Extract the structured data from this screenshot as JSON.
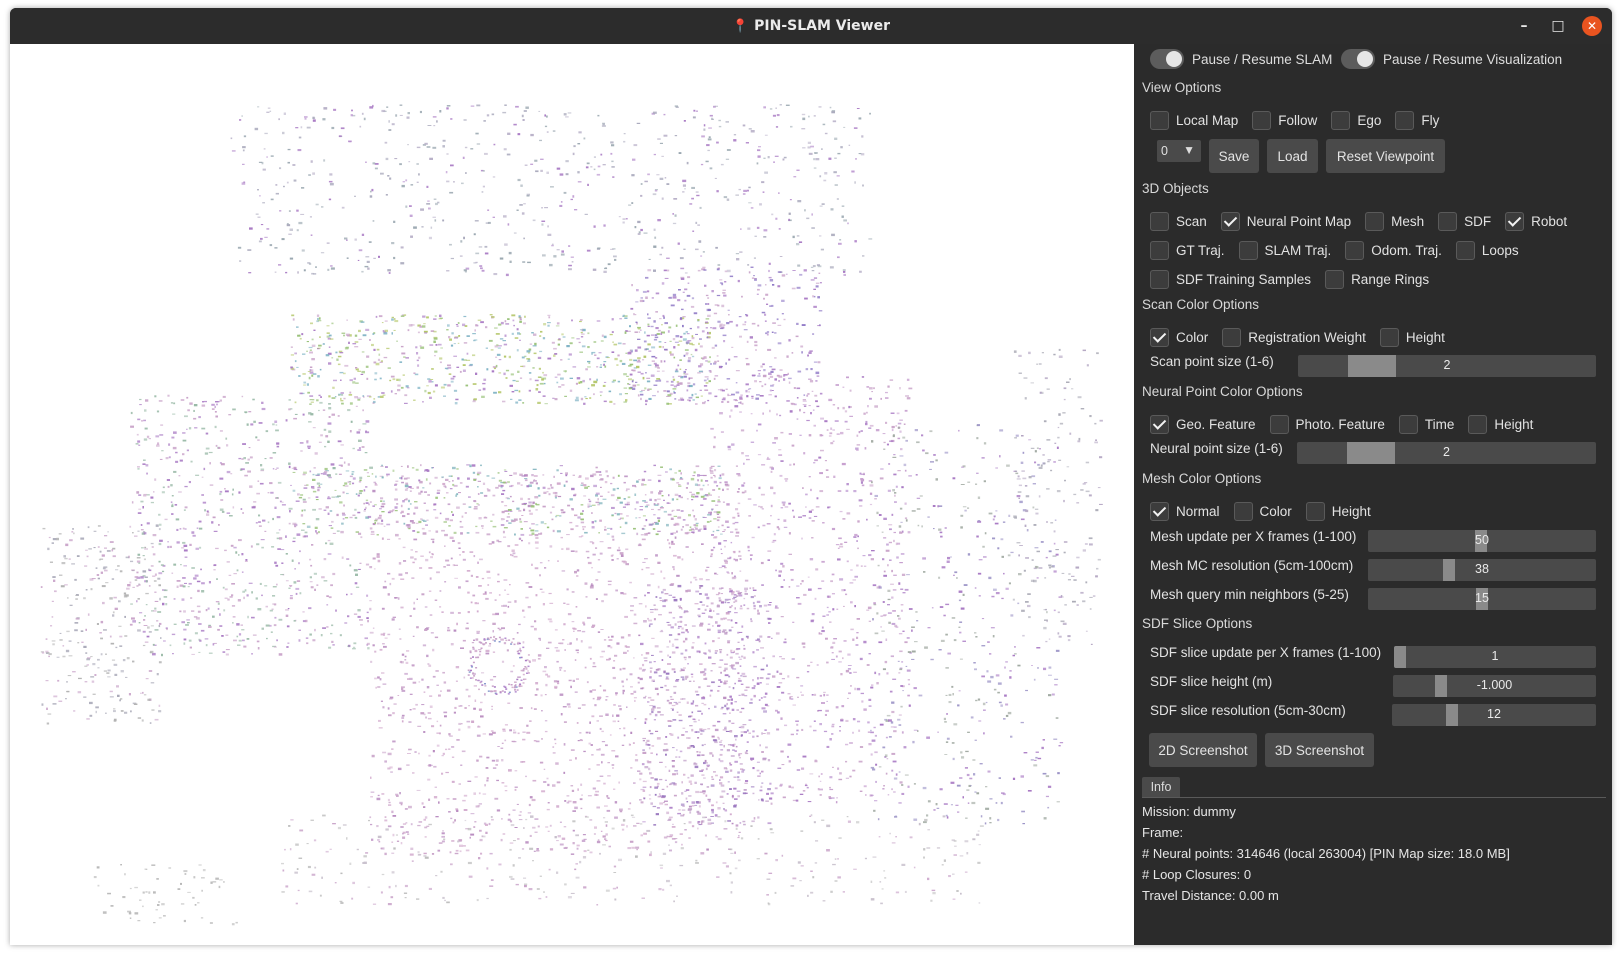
{
  "window": {
    "title": "PIN-SLAM Viewer",
    "minimize": "–",
    "maximize": "□",
    "close": "✕"
  },
  "toggles": {
    "pause_slam": "Pause / Resume SLAM",
    "pause_vis": "Pause / Resume Visualization"
  },
  "view_options": {
    "title": "View Options",
    "checkboxes": [
      {
        "label": "Local Map",
        "checked": false
      },
      {
        "label": "Follow",
        "checked": false
      },
      {
        "label": "Ego",
        "checked": false
      },
      {
        "label": "Fly",
        "checked": false
      }
    ],
    "combo_value": "0",
    "save": "Save",
    "load": "Load",
    "reset": "Reset Viewpoint"
  },
  "objects": {
    "title": "3D Objects",
    "row1": [
      {
        "label": "Scan",
        "checked": false
      },
      {
        "label": "Neural Point Map",
        "checked": true
      },
      {
        "label": "Mesh",
        "checked": false
      },
      {
        "label": "SDF",
        "checked": false
      },
      {
        "label": "Robot",
        "checked": true
      }
    ],
    "row2": [
      {
        "label": "GT Traj.",
        "checked": false
      },
      {
        "label": "SLAM Traj.",
        "checked": false
      },
      {
        "label": "Odom. Traj.",
        "checked": false
      },
      {
        "label": "Loops",
        "checked": false
      }
    ],
    "row3": [
      {
        "label": "SDF Training Samples",
        "checked": false
      },
      {
        "label": "Range Rings",
        "checked": false
      }
    ]
  },
  "scan_color": {
    "title": "Scan Color Options",
    "checkboxes": [
      {
        "label": "Color",
        "checked": true
      },
      {
        "label": "Registration Weight",
        "checked": false
      },
      {
        "label": "Height",
        "checked": false
      }
    ],
    "point_size_label": "Scan point size (1-6)",
    "point_size": "2",
    "point_size_min": 1,
    "point_size_max": 6
  },
  "neural_color": {
    "title": "Neural Point Color Options",
    "checkboxes": [
      {
        "label": "Geo. Feature",
        "checked": true
      },
      {
        "label": "Photo. Feature",
        "checked": false
      },
      {
        "label": "Time",
        "checked": false
      },
      {
        "label": "Height",
        "checked": false
      }
    ],
    "point_size_label": "Neural point size (1-6)",
    "point_size": "2",
    "point_size_min": 1,
    "point_size_max": 6
  },
  "mesh_color": {
    "title": "Mesh Color Options",
    "checkboxes": [
      {
        "label": "Normal",
        "checked": true
      },
      {
        "label": "Color",
        "checked": false
      },
      {
        "label": "Height",
        "checked": false
      }
    ],
    "update_label": "Mesh update per X frames (1-100)",
    "update_value": "50",
    "update_min": 1,
    "update_max": 100,
    "mc_label": "Mesh MC resolution (5cm-100cm)",
    "mc_value": "38",
    "mc_min": 5,
    "mc_max": 100,
    "neighbors_label": "Mesh query min neighbors (5-25)",
    "neighbors_value": "15",
    "neighbors_min": 5,
    "neighbors_max": 25
  },
  "sdf_slice": {
    "title": "SDF Slice Options",
    "update_label": "SDF slice update per X frames (1-100)",
    "update_value": "1",
    "update_min": 1,
    "update_max": 100,
    "height_label": "SDF slice height (m)",
    "height_value": "-1.000",
    "height_level": 0.22,
    "res_label": "SDF slice resolution (5cm-30cm)",
    "res_value": "12",
    "res_min": 5,
    "res_max": 30
  },
  "screenshots": {
    "btn2d": "2D Screenshot",
    "btn3d": "3D Screenshot"
  },
  "info": {
    "tab": "Info",
    "mission": "Mission: dummy",
    "frame": "Frame:",
    "neural_points": "# Neural points: 314646 (local 263004) [PIN Map size: 18.0 MB]",
    "loop_closures": "# Loop Closures: 0",
    "travel_distance": "Travel Distance: 0.00 m"
  },
  "colors": {
    "panel_bg": "#2b2b2b",
    "widget_bg": "#4a4a4a",
    "accent_close": "#e95420",
    "cloud_pink": "#c9a3c9",
    "cloud_purple": "#a97ac4",
    "cloud_green": "#9ac27a"
  }
}
